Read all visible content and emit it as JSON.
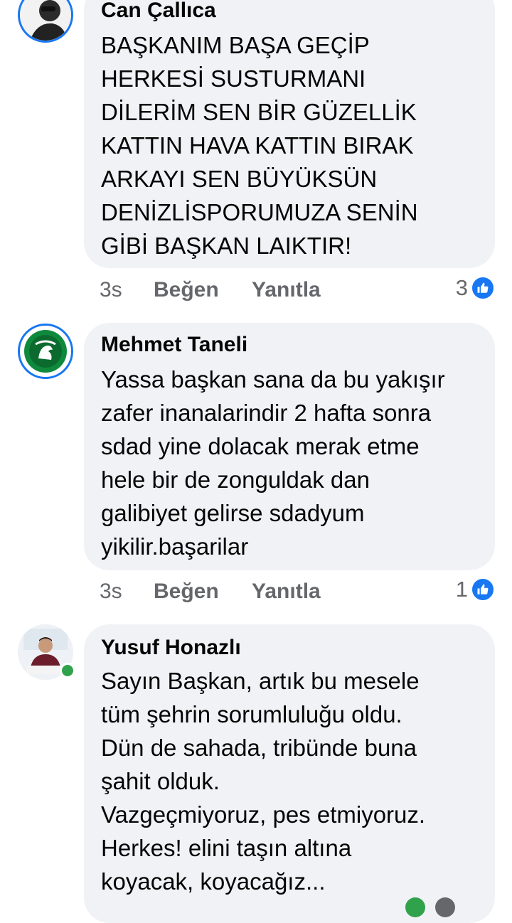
{
  "comments": [
    {
      "author": "Can Çallıca",
      "text": "BAŞKANIM BAŞA GEÇİP\nHERKESİ SUSTURMANI\nDİLERİM SEN BİR GÜZELLİK\nKATTIN HAVA KATTIN BIRAK\nARKAYI SEN BÜYÜKSÜN\nDENİZLİSPORUMUZA SENİN\nGİBİ BAŞKAN LAIKTIR!",
      "time": "3s",
      "like_label": "Beğen",
      "reply_label": "Yanıtla",
      "reaction_count": "3",
      "reaction_icon": "thumbs-up-icon"
    },
    {
      "author": "Mehmet Taneli",
      "text": "Yassa başkan sana da bu yakışır\nzafer inanalarindir  2 hafta sonra\nsdad yine dolacak merak etme\nhele  bir de zonguldak dan\ngalibiyet  gelirse   sdadyum\nyikilir.başarilar",
      "time": "3s",
      "like_label": "Beğen",
      "reply_label": "Yanıtla",
      "reaction_count": "1",
      "reaction_icon": "thumbs-up-icon"
    },
    {
      "author": "Yusuf Honazlı",
      "text": "Sayın Başkan, artık bu mesele\ntüm şehrin sorumluluğu oldu.\nDün de sahada, tribünde buna\nşahit olduk.\nVazgeçmiyoruz, pes etmiyoruz.\nHerkes! elini taşın altına\nkoyacak, koyacağız...",
      "online": true
    }
  ],
  "colors": {
    "bubble": "#f0f2f5",
    "meta_text": "#65676b",
    "like_blue": "#1877f2",
    "online_green": "#31a24c",
    "club_green": "#0f8a3c"
  }
}
